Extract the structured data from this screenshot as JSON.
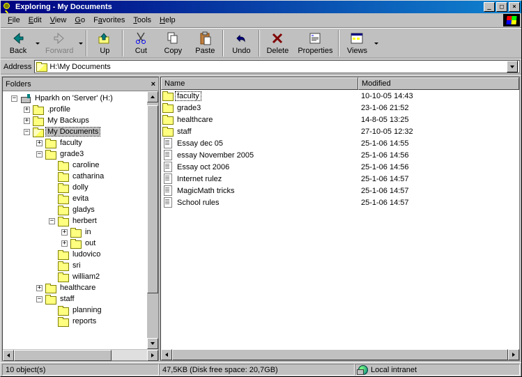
{
  "title": "Exploring - My Documents",
  "menu": [
    "File",
    "Edit",
    "View",
    "Go",
    "Favorites",
    "Tools",
    "Help"
  ],
  "toolbar": {
    "back": "Back",
    "forward": "Forward",
    "up": "Up",
    "cut": "Cut",
    "copy": "Copy",
    "paste": "Paste",
    "undo": "Undo",
    "delete": "Delete",
    "properties": "Properties",
    "views": "Views"
  },
  "address_label": "Address",
  "address_value": "H:\\My Documents",
  "folders_title": "Folders",
  "tree": {
    "root": "Hparkh on 'Server' (H:)",
    "profile": ".profile",
    "mybackups": "My Backups",
    "mydocs": "My Documents",
    "faculty": "faculty",
    "grade3": "grade3",
    "caroline": "caroline",
    "catharina": "catharina",
    "dolly": "dolly",
    "evita": "evita",
    "gladys": "gladys",
    "herbert": "herbert",
    "in": "in",
    "out": "out",
    "ludovico": "ludovico",
    "sri": "sri",
    "william2": "william2",
    "healthcare": "healthcare",
    "staff": "staff",
    "planning": "planning",
    "reports": "reports"
  },
  "columns": {
    "name": "Name",
    "modified": "Modified"
  },
  "files": {
    "faculty": {
      "n": "faculty",
      "m": "10-10-05 14:43",
      "t": "folder"
    },
    "grade3": {
      "n": "grade3",
      "m": "23-1-06 21:52",
      "t": "folder"
    },
    "healthcare": {
      "n": "healthcare",
      "m": "14-8-05 13:25",
      "t": "folder"
    },
    "staff": {
      "n": "staff",
      "m": "27-10-05 12:32",
      "t": "folder"
    },
    "essay_dec": {
      "n": "Essay dec 05",
      "m": "25-1-06 14:55",
      "t": "doc"
    },
    "essay_nov": {
      "n": "essay November 2005",
      "m": "25-1-06 14:56",
      "t": "doc"
    },
    "essay_oct": {
      "n": "Essay oct 2006",
      "m": "25-1-06 14:56",
      "t": "doc"
    },
    "internet": {
      "n": "Internet rulez",
      "m": "25-1-06 14:57",
      "t": "doc"
    },
    "magic": {
      "n": "MagicMath tricks",
      "m": "25-1-06 14:57",
      "t": "doc"
    },
    "school": {
      "n": "School rules",
      "m": "25-1-06 14:57",
      "t": "doc"
    }
  },
  "status": {
    "count": "10 object(s)",
    "size": "47,5KB (Disk free space: 20,7GB)",
    "zone": "Local intranet"
  }
}
